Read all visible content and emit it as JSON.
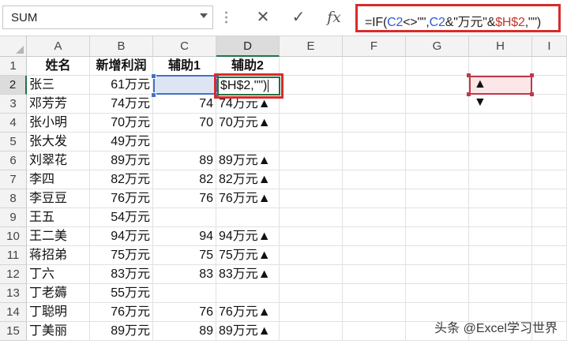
{
  "namebox": {
    "value": "SUM"
  },
  "formula_bar": {
    "cancel_icon": "✕",
    "enter_icon": "✓",
    "fx_label": "fx",
    "formula_parts": [
      {
        "text": "=IF(",
        "color": "dark"
      },
      {
        "text": "C2",
        "color": "blue"
      },
      {
        "text": "<>\"\",",
        "color": "dark"
      },
      {
        "text": "C2",
        "color": "blue"
      },
      {
        "text": "&\"万元\"&",
        "color": "dark"
      },
      {
        "text": "$H$2",
        "color": "red"
      },
      {
        "text": ",\"\")",
        "color": "dark"
      }
    ]
  },
  "columns": [
    "A",
    "B",
    "C",
    "D",
    "E",
    "F",
    "G",
    "H",
    "I"
  ],
  "rows": [
    "1",
    "2",
    "3",
    "4",
    "5",
    "6",
    "7",
    "8",
    "9",
    "10",
    "11",
    "12",
    "13",
    "14",
    "15"
  ],
  "headers": {
    "a": "姓名",
    "b": "新增利润",
    "c": "辅助1",
    "d": "辅助2"
  },
  "table": [
    {
      "a": "张三",
      "b": "61万元",
      "c": "",
      "d": ""
    },
    {
      "a": "邓芳芳",
      "b": "74万元",
      "c": "74",
      "d": "74万元▲"
    },
    {
      "a": "张小明",
      "b": "70万元",
      "c": "70",
      "d": "70万元▲"
    },
    {
      "a": "张大发",
      "b": "49万元",
      "c": "",
      "d": ""
    },
    {
      "a": "刘翠花",
      "b": "89万元",
      "c": "89",
      "d": "89万元▲"
    },
    {
      "a": "李四",
      "b": "82万元",
      "c": "82",
      "d": "82万元▲"
    },
    {
      "a": "李豆豆",
      "b": "76万元",
      "c": "76",
      "d": "76万元▲"
    },
    {
      "a": "王五",
      "b": "54万元",
      "c": "",
      "d": ""
    },
    {
      "a": "王二美",
      "b": "94万元",
      "c": "94",
      "d": "94万元▲"
    },
    {
      "a": "蒋招弟",
      "b": "75万元",
      "c": "75",
      "d": "75万元▲"
    },
    {
      "a": "丁六",
      "b": "83万元",
      "c": "83",
      "d": "83万元▲"
    },
    {
      "a": "丁老薅",
      "b": "55万元",
      "c": "",
      "d": ""
    },
    {
      "a": "丁聪明",
      "b": "76万元",
      "c": "76",
      "d": "76万元▲"
    },
    {
      "a": "丁美丽",
      "b": "89万元",
      "c": "89",
      "d": "89万元▲"
    }
  ],
  "editing_cell": {
    "text": "$H$2,\"\")"
  },
  "h_cells": {
    "h2": "▲",
    "h3": "▼"
  },
  "watermark": "头条 @Excel学习世界",
  "colors": {
    "formula_blue": "#2a5bd7",
    "formula_red": "#c0392b",
    "highlight_red": "#d92b2b",
    "selection_green": "#217346"
  }
}
